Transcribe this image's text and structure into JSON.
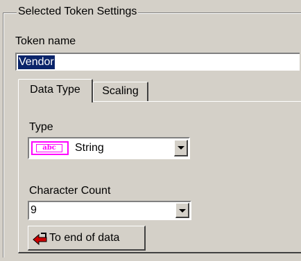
{
  "group": {
    "title": "Selected Token Settings"
  },
  "token_name": {
    "label": "Token name",
    "value": "Vendor"
  },
  "tabs": [
    {
      "label": "Data Type",
      "selected": true
    },
    {
      "label": "Scaling",
      "selected": false
    }
  ],
  "data_type": {
    "type_label": "Type",
    "type_value": "String",
    "type_icon": "abc-string-icon",
    "type_icon_text": "abc",
    "char_count_label": "Character Count",
    "char_count_value": "9",
    "to_end_button_label": "To end of data",
    "to_end_icon": "red-arrow-left-icon"
  },
  "colors": {
    "window_bg": "#d4d0c8",
    "selection_bg": "#0a246a",
    "icon_magenta": "#ff00ff",
    "arrow_red": "#cc0000"
  }
}
